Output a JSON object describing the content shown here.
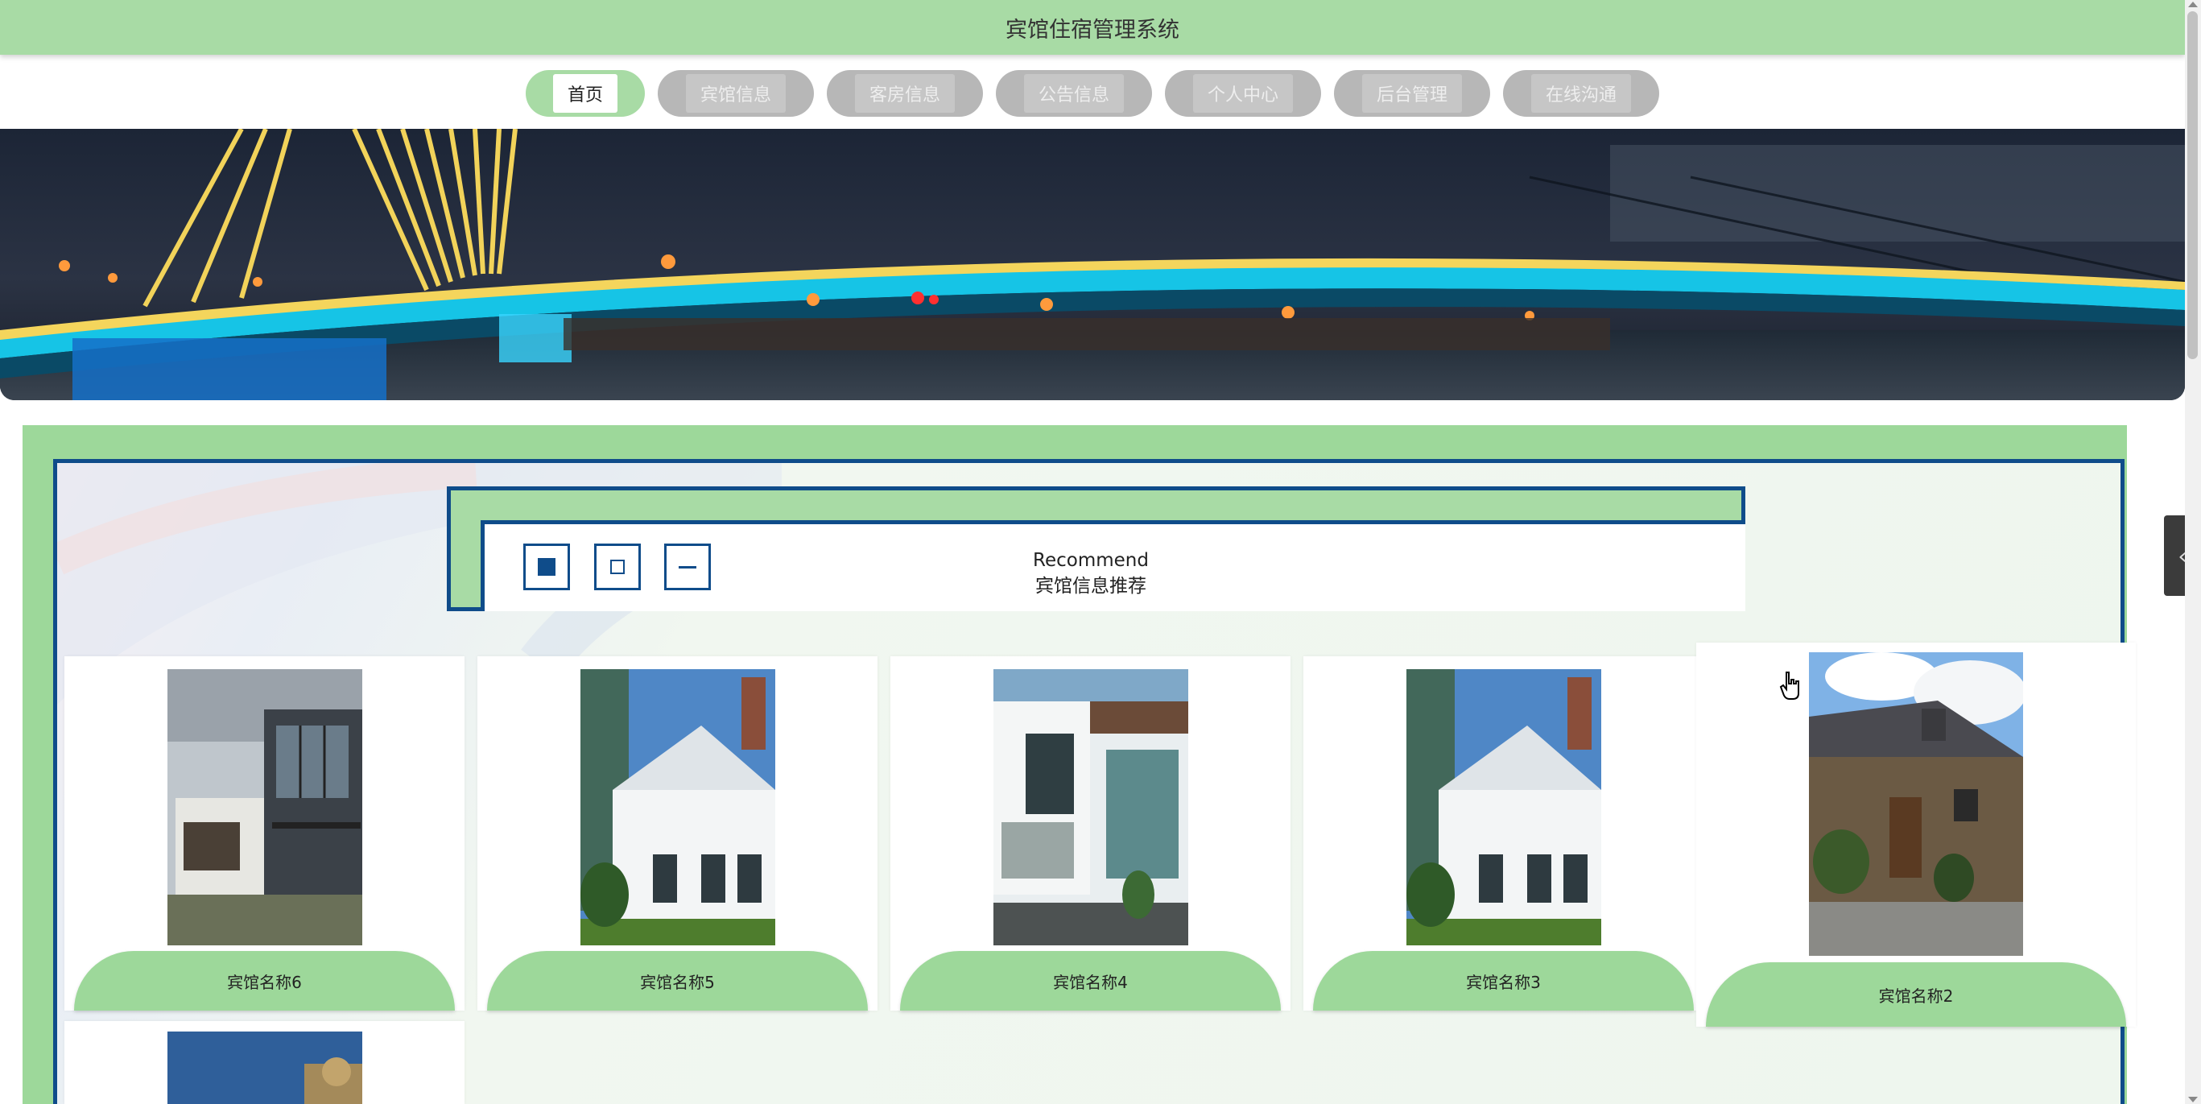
{
  "header": {
    "title": "宾馆住宿管理系统"
  },
  "nav": {
    "items": [
      {
        "label": "首页",
        "active": true
      },
      {
        "label": "宾馆信息",
        "active": false
      },
      {
        "label": "客房信息",
        "active": false
      },
      {
        "label": "公告信息",
        "active": false
      },
      {
        "label": "个人中心",
        "active": false
      },
      {
        "label": "后台管理",
        "active": false
      },
      {
        "label": "在线沟通",
        "active": false
      }
    ]
  },
  "banner": {
    "subject": "night bridge with cyan lights"
  },
  "recommend": {
    "title_en": "Recommend",
    "title_cn": "宾馆信息推荐",
    "icons": [
      "square-filled-icon",
      "square-outline-icon",
      "minus-icon"
    ]
  },
  "cards": [
    {
      "name": "宾馆名称6",
      "photo": "modern-house-photo"
    },
    {
      "name": "宾馆名称5",
      "photo": "white-farmhouse-photo"
    },
    {
      "name": "宾馆名称4",
      "photo": "modern-villa-photo"
    },
    {
      "name": "宾馆名称3",
      "photo": "white-farmhouse-photo"
    },
    {
      "name": "宾馆名称2",
      "photo": "stone-cottage-photo"
    },
    {
      "name": "",
      "photo": "partial-photo"
    }
  ],
  "side": {
    "collapse_icon": "chevron-left-icon"
  },
  "colors": {
    "accent_green": "#9dd89a",
    "header_green": "#a8dba5",
    "border_blue": "#0f4c8a",
    "nav_inactive": "#b7b7b7"
  }
}
